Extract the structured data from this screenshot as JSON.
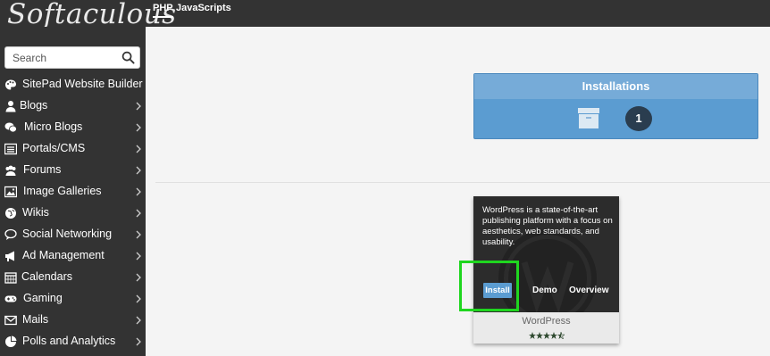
{
  "app": {
    "logo_text": "Softaculous"
  },
  "top_tabs": [
    {
      "label": "PHP",
      "active": true
    },
    {
      "label": "JavaScripts",
      "active": false
    }
  ],
  "search": {
    "placeholder": "Search",
    "value": ""
  },
  "sidebar": {
    "items": [
      {
        "label": "SitePad Website Builder",
        "icon": "palette-icon",
        "has_arrow": false
      },
      {
        "label": "Blogs",
        "icon": "user-icon",
        "has_arrow": true
      },
      {
        "label": "Micro Blogs",
        "icon": "comments-icon",
        "has_arrow": true
      },
      {
        "label": "Portals/CMS",
        "icon": "list-icon",
        "has_arrow": true
      },
      {
        "label": "Forums",
        "icon": "users-icon",
        "has_arrow": true
      },
      {
        "label": "Image Galleries",
        "icon": "image-icon",
        "has_arrow": true
      },
      {
        "label": "Wikis",
        "icon": "globe-icon",
        "has_arrow": true
      },
      {
        "label": "Social Networking",
        "icon": "chat-icon",
        "has_arrow": true
      },
      {
        "label": "Ad Management",
        "icon": "megaphone-icon",
        "has_arrow": true
      },
      {
        "label": "Calendars",
        "icon": "calendar-icon",
        "has_arrow": true
      },
      {
        "label": "Gaming",
        "icon": "gamepad-icon",
        "has_arrow": true
      },
      {
        "label": "Mails",
        "icon": "envelope-icon",
        "has_arrow": true
      },
      {
        "label": "Polls and Analytics",
        "icon": "pie-chart-icon",
        "has_arrow": true
      }
    ]
  },
  "installations": {
    "title": "Installations",
    "count": "1",
    "icon": "archive-box-icon"
  },
  "app_card": {
    "name": "WordPress",
    "description": "WordPress is a state-of-the-art publishing platform with a focus on aesthetics, web standards, and usability.",
    "install_label": "Install",
    "demo_label": "Demo",
    "overview_label": "Overview",
    "rating": 4.5
  },
  "colors": {
    "sidebar_bg": "#333333",
    "accent": "#5b9cd1",
    "highlight": "#1fd61f"
  }
}
